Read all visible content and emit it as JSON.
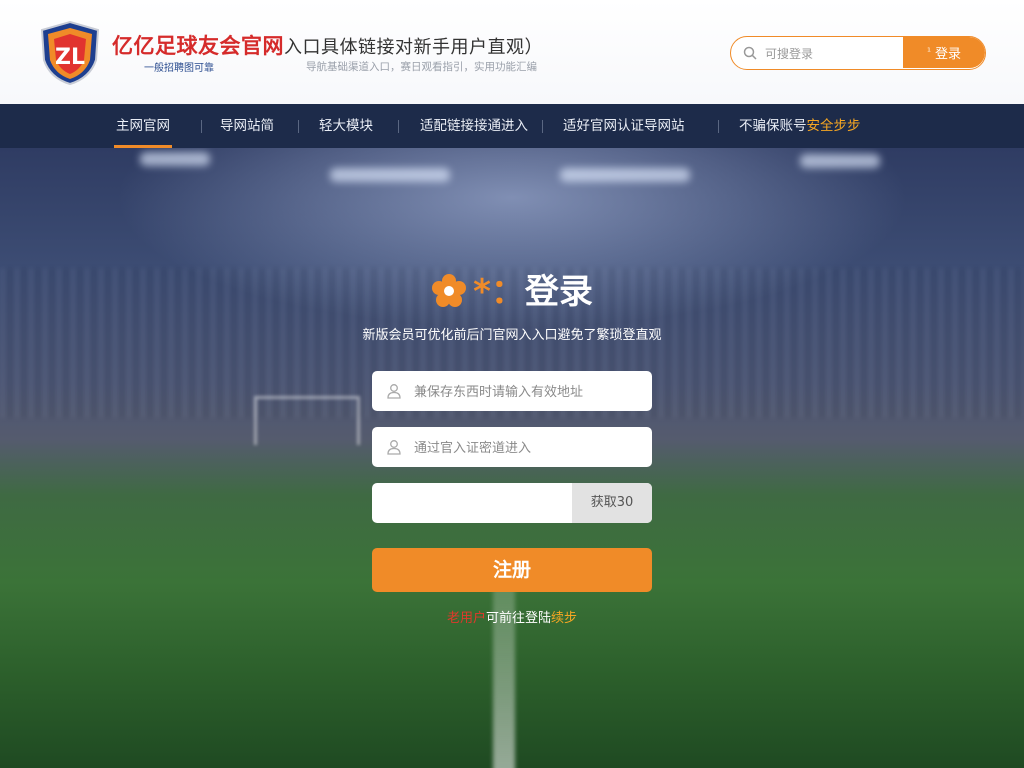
{
  "header": {
    "brand_title": "亿亿足球友会官网",
    "brand_title_rest": "入口具体链接对新手用户直观）",
    "brand_sub": "一般招聘图可靠",
    "brand_sub2": "导航基础渠道入口，赛日观看指引，实用功能汇编",
    "search": {
      "placeholder": "可搜登录",
      "button_label": "登录",
      "button_prefix": "¹"
    }
  },
  "nav": {
    "items": [
      {
        "label": "主网官网"
      },
      {
        "label": "导网站简"
      },
      {
        "label": "轻大模块"
      },
      {
        "label": "适配链接接通进入"
      },
      {
        "label": "适好官网认证导网站"
      },
      {
        "label": "不骗保账号",
        "highlight": "安全步步"
      }
    ]
  },
  "login": {
    "title_star": "*",
    "title_colon": "：",
    "title": "登录",
    "subtitle": "新版会员可优化前后门官网入入口避免了繁琐登直观",
    "username_placeholder": "兼保存东西时请输入有效地址",
    "password_placeholder": "通过官入证密道进入",
    "captcha_placeholder": "",
    "code_button": "获取30",
    "register_button": "注册",
    "note_red": "老用户",
    "note_white": "可前往登陆",
    "note_orange": "续步"
  },
  "colors": {
    "accent": "#f08b28",
    "nav_bg": "#1d2b4a",
    "brand_red": "#d52b2b"
  },
  "icons": {
    "logo": "club-shield-logo",
    "search": "search-icon",
    "user": "user-icon",
    "flower": "flower-icon"
  }
}
